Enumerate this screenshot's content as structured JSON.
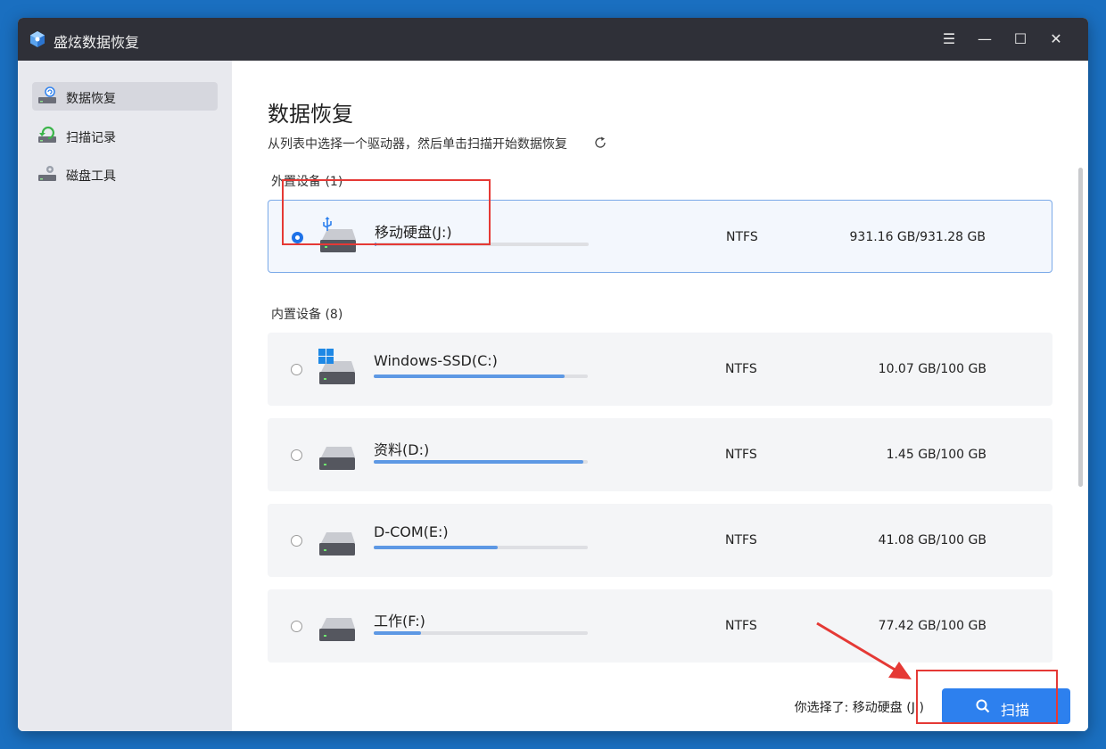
{
  "app": {
    "title": "盛炫数据恢复",
    "controls": [
      "☰",
      "—",
      "☐",
      "✕"
    ]
  },
  "sidebar": {
    "items": [
      {
        "label": "数据恢复",
        "icon": "data-recovery-icon",
        "active": true
      },
      {
        "label": "扫描记录",
        "icon": "scan-history-icon",
        "active": false
      },
      {
        "label": "磁盘工具",
        "icon": "disk-tools-icon",
        "active": false
      }
    ]
  },
  "main": {
    "title": "数据恢复",
    "subtitle": "从列表中选择一个驱动器，然后单击扫描开始数据恢复",
    "external_label": "外置设备 (1)",
    "internal_label": "内置设备 (8)",
    "external_drives": [
      {
        "name": "移动硬盘(J:)",
        "fs": "NTFS",
        "capacity": "931.16 GB/931.28 GB",
        "usage": 0.01,
        "selected": true,
        "icon": "usb-drive-icon"
      }
    ],
    "internal_drives": [
      {
        "name": "Windows-SSD(C:)",
        "fs": "NTFS",
        "capacity": "10.07 GB/100 GB",
        "usage": 0.89,
        "selected": false,
        "icon": "windows-drive-icon"
      },
      {
        "name": "资料(D:)",
        "fs": "NTFS",
        "capacity": "1.45 GB/100 GB",
        "usage": 0.98,
        "selected": false,
        "icon": "hard-drive-icon"
      },
      {
        "name": "D-COM(E:)",
        "fs": "NTFS",
        "capacity": "41.08 GB/100 GB",
        "usage": 0.58,
        "selected": false,
        "icon": "hard-drive-icon"
      },
      {
        "name": "工作(F:)",
        "fs": "NTFS",
        "capacity": "77.42 GB/100 GB",
        "usage": 0.22,
        "selected": false,
        "icon": "hard-drive-icon"
      }
    ]
  },
  "footer": {
    "selected_text": "你选择了: 移动硬盘 (J:)",
    "scan_label": "扫描"
  },
  "colors": {
    "accent": "#2d80ee",
    "annotation": "#e53935",
    "titlebar": "#2f3038"
  }
}
